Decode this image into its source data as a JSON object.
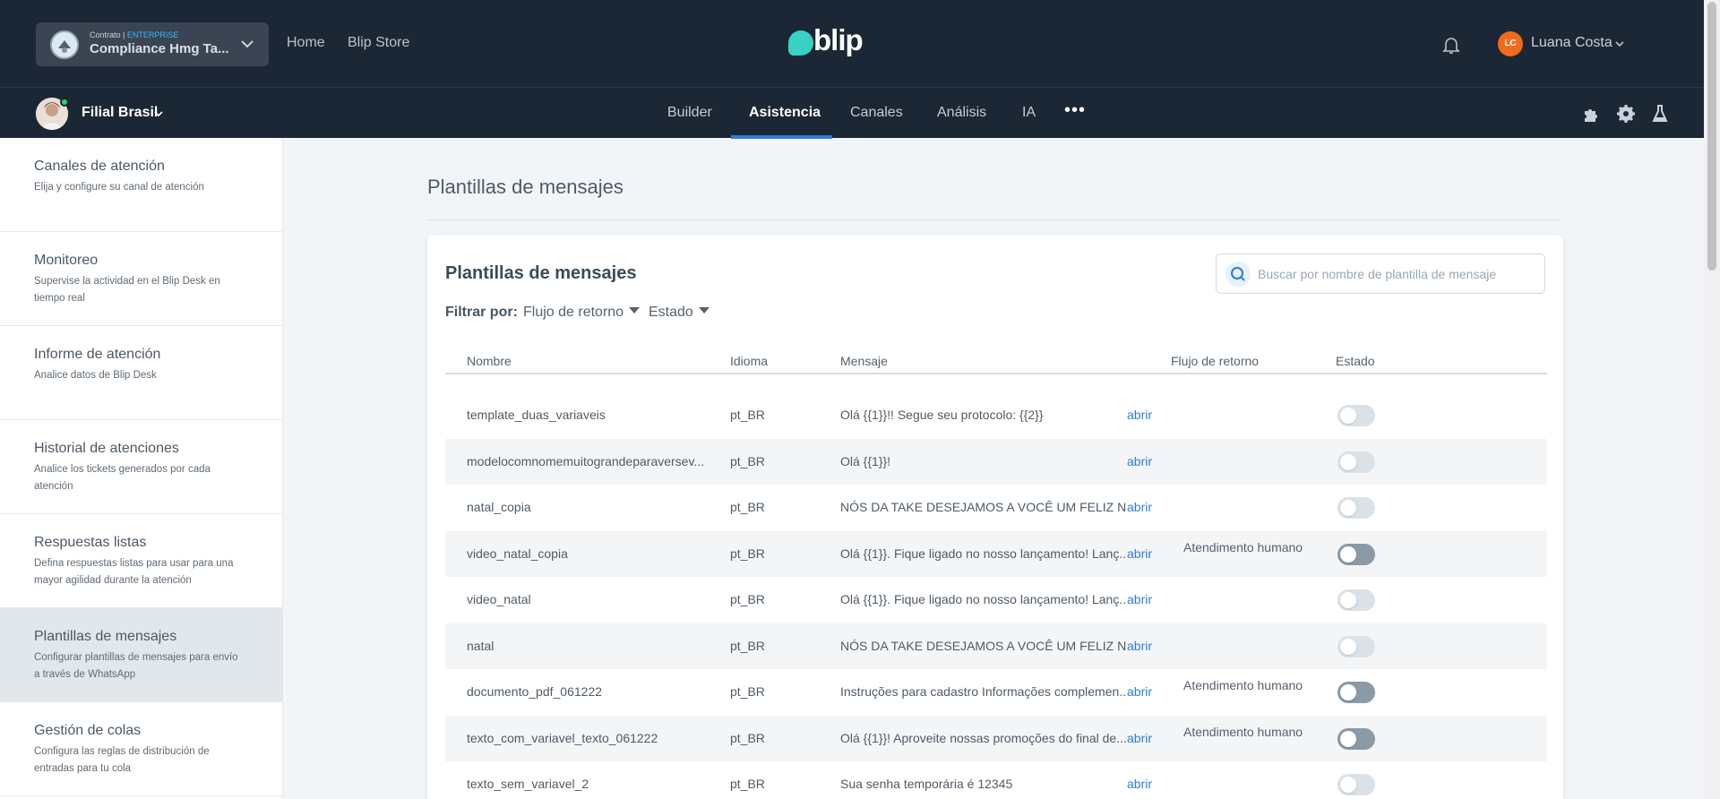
{
  "header": {
    "contract": {
      "prefix": "Contrato | ",
      "tier": "ENTERPRISE",
      "name": "Compliance Hmg Ta..."
    },
    "nav": [
      {
        "label": "Home"
      },
      {
        "label": "Blip Store"
      }
    ],
    "brand": "blip",
    "user": {
      "initials": "LC",
      "name": "Luana Costa"
    }
  },
  "subnav": {
    "bot_name": "Filial Brasil",
    "tabs": [
      {
        "label": "Builder"
      },
      {
        "label": "Asistencia"
      },
      {
        "label": "Canales"
      },
      {
        "label": "Análisis"
      },
      {
        "label": "IA"
      }
    ],
    "more": "•••"
  },
  "sidebar": {
    "items": [
      {
        "title": "Canales de atención",
        "desc": "Elija y configure su canal de atención"
      },
      {
        "title": "Monitoreo",
        "desc": "Supervise la actividad en el Blip Desk en tiempo real"
      },
      {
        "title": "Informe de atención",
        "desc": "Analice datos de Blip Desk"
      },
      {
        "title": "Historial de atenciones",
        "desc": "Analice los tickets generados por cada atención"
      },
      {
        "title": "Respuestas listas",
        "desc": "Defina respuestas listas para usar para una mayor agilidad durante la atención"
      },
      {
        "title": "Plantillas de mensajes",
        "desc": "Configurar plantillas de mensajes para envío a través de WhatsApp"
      },
      {
        "title": "Gestión de colas",
        "desc": "Configura las reglas de distribución de entradas para tu cola"
      }
    ]
  },
  "main": {
    "page_title": "Plantillas de mensajes",
    "card_title": "Plantillas de mensajes",
    "search_placeholder": "Buscar por nombre de plantilla de mensaje",
    "filter_label": "Filtrar por:",
    "filters": [
      {
        "label": "Flujo de retorno"
      },
      {
        "label": "Estado"
      }
    ],
    "columns": {
      "name": "Nombre",
      "lang": "Idioma",
      "msg": "Mensaje",
      "flow": "Flujo de retorno",
      "status": "Estado"
    },
    "rows": [
      {
        "name": "template_duas_variaveis",
        "lang": "pt_BR",
        "msg": "Olá {{1}}!! Segue seu protocolo: {{2}}",
        "open": "abrir",
        "flow": "",
        "status_active": false
      },
      {
        "name": "modelocomnomemuitograndeparaversev...",
        "lang": "pt_BR",
        "msg": "Olá {{1}}!",
        "open": "abrir",
        "flow": "",
        "status_active": false
      },
      {
        "name": "natal_copia",
        "lang": "pt_BR",
        "msg": "NÓS DA TAKE DESEJAMOS A VOCÊ UM FELIZ N...",
        "open": "abrir",
        "flow": "",
        "status_active": false
      },
      {
        "name": "video_natal_copia",
        "lang": "pt_BR",
        "msg": "Olá {{1}}. Fique ligado no nosso lançamento! Lanç...",
        "open": "abrir",
        "flow": "Atendimento humano",
        "status_active": true
      },
      {
        "name": "video_natal",
        "lang": "pt_BR",
        "msg": "Olá {{1}}. Fique ligado no nosso lançamento! Lanç...",
        "open": "abrir",
        "flow": "",
        "status_active": false
      },
      {
        "name": "natal",
        "lang": "pt_BR",
        "msg": "NÓS DA TAKE DESEJAMOS A VOCÊ UM FELIZ N...",
        "open": "abrir",
        "flow": "",
        "status_active": false
      },
      {
        "name": "documento_pdf_061222",
        "lang": "pt_BR",
        "msg": "Instruções para cadastro Informações complemen...",
        "open": "abrir",
        "flow": "Atendimento humano",
        "status_active": true
      },
      {
        "name": "texto_com_variavel_texto_061222",
        "lang": "pt_BR",
        "msg": "Olá {{1}}! Aproveite nossas promoções do final de...",
        "open": "abrir",
        "flow": "Atendimento humano",
        "status_active": true
      },
      {
        "name": "texto_sem_variavel_2",
        "lang": "pt_BR",
        "msg": "Sua senha temporária é 12345",
        "open": "abrir",
        "flow": "",
        "status_active": false
      }
    ]
  },
  "colors": {
    "header_bg": "#1c2735",
    "accent": "#2f7dd1",
    "brand": "#37d2c4",
    "avatar": "#f26b1d"
  }
}
